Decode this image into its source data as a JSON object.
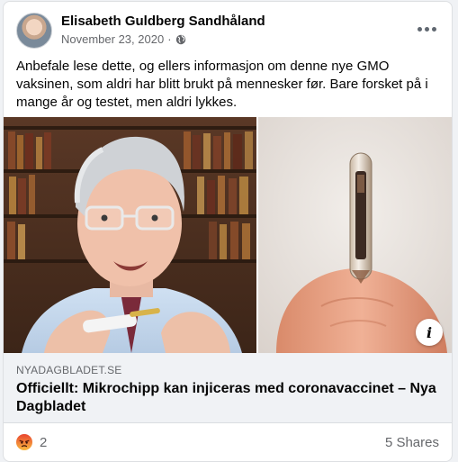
{
  "post": {
    "author": "Elisabeth Guldberg Sandhåland",
    "date": "November 23, 2020",
    "separator": "·",
    "text": "Anbefale lese dette, og ellers informasjon om denne nye GMO vaksinen, som aldri har blitt brukt på mennesker før. Bare forsket på i mange år og testet, men aldri lykkes."
  },
  "link": {
    "domain": "NYADAGBLADET.SE",
    "title": "Officiellt: Mikrochipp kan injiceras med coronavaccinet – Nya Dagbladet",
    "info_label": "i"
  },
  "footer": {
    "reaction_count": "2",
    "shares": "5 Shares"
  },
  "icons": {
    "globe": "globe-icon",
    "more": "more-options-icon",
    "reaction": "angry-reaction-icon"
  },
  "colors": {
    "link_box_bg": "#f0f2f5",
    "secondary_text": "#65676b",
    "angry_face": "#f0662b"
  }
}
